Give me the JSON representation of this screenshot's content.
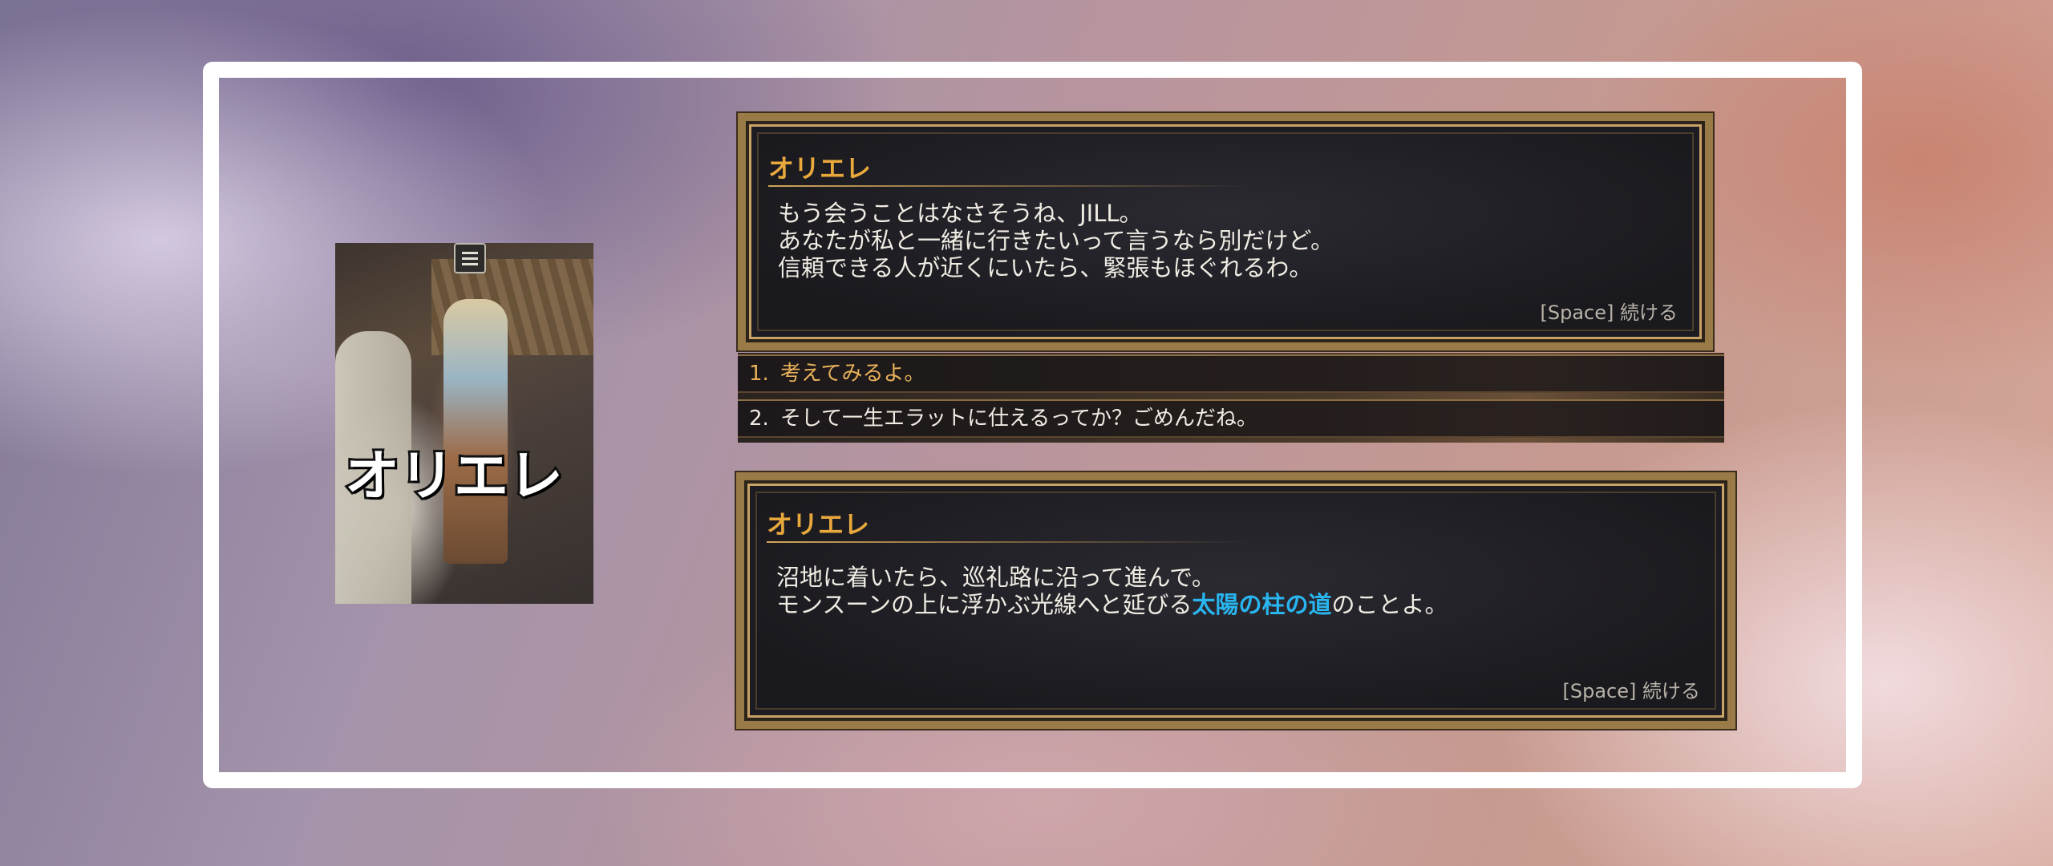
{
  "thumbnail": {
    "label": "オリエレ",
    "icon": "speech-bubble-icon"
  },
  "dialog_top": {
    "speaker": "オリエレ",
    "lines": [
      "もう会うことはなさそうね、JILL。",
      "あなたが私と一緒に行きたいって言うなら別だけど。",
      "信頼できる人が近くにいたら、緊張もほぐれるわ。"
    ],
    "continue_label": "[Space] 続ける"
  },
  "choices": [
    {
      "number": "1.",
      "text": "考えてみるよ。"
    },
    {
      "number": "2.",
      "text": "そして一生エラットに仕えるってか？ごめんだね。"
    }
  ],
  "dialog_bottom": {
    "speaker": "オリエレ",
    "line1": "沼地に着いたら、巡礼路に沿って進んで。",
    "line2_prefix": "モンスーンの上に浮かぶ光線へと延びる",
    "line2_highlight": "太陽の柱の道",
    "line2_suffix": "のことよ。",
    "continue_label": "[Space] 続ける"
  },
  "colors": {
    "speaker": "#e8a83c",
    "highlight": "#29b6f0",
    "frame": "#ffffff"
  }
}
